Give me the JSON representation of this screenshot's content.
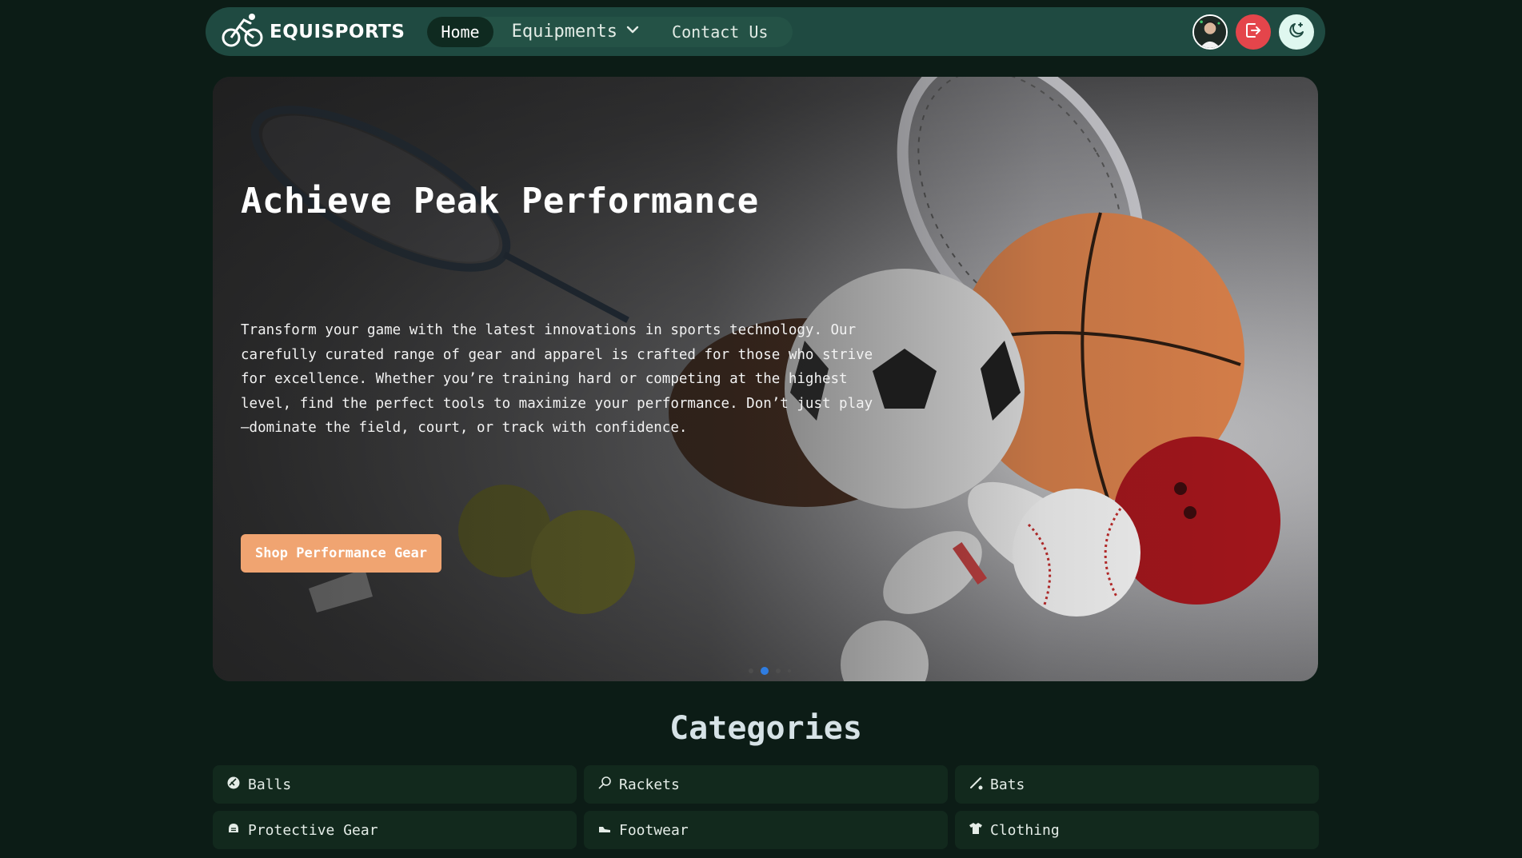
{
  "nav": {
    "brand": "EQUISPORTS",
    "links": [
      {
        "label": "Home",
        "active": true
      },
      {
        "label": "Equipments",
        "dropdown": true
      },
      {
        "label": "Contact Us"
      }
    ],
    "icons": {
      "logo": "cyclist-logo-icon",
      "avatar": "user-avatar",
      "logout": "logout-icon",
      "theme": "moon-star-icon"
    },
    "colors": {
      "bar": "#1f4a41",
      "logout": "#e4454b",
      "theme": "#dff7ef"
    }
  },
  "hero": {
    "title": "Achieve Peak Performance",
    "text": "Transform your game with the latest innovations in sports technology. Our carefully curated range of gear and apparel is crafted for those who strive for excellence. Whether you’re training hard or competing at the highest level, find the perfect tools to maximize your performance. Don’t just play—dominate the field, court, or track with confidence.",
    "cta": "Shop Performance Gear",
    "cta_color": "#f0a471",
    "slides": 4,
    "active_slide": 2
  },
  "categories": {
    "title": "Categories",
    "items": [
      {
        "label": "Balls",
        "icon": "football-icon"
      },
      {
        "label": "Rackets",
        "icon": "racket-icon"
      },
      {
        "label": "Bats",
        "icon": "bat-icon"
      },
      {
        "label": "Protective Gear",
        "icon": "helmet-icon"
      },
      {
        "label": "Footwear",
        "icon": "shoe-icon"
      },
      {
        "label": "Clothing",
        "icon": "shirt-icon"
      }
    ]
  }
}
